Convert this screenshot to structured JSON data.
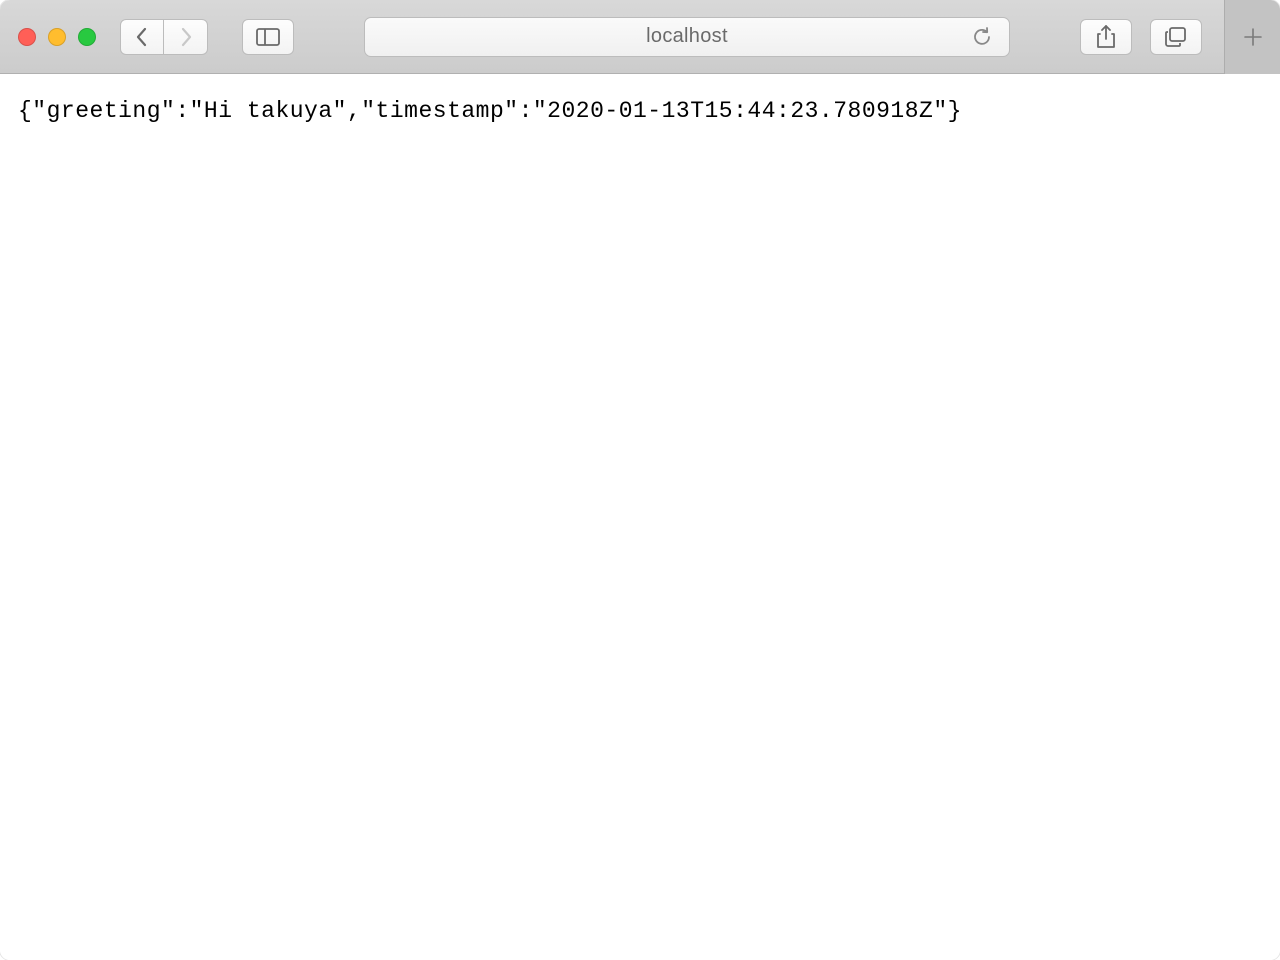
{
  "toolbar": {
    "address": "localhost"
  },
  "content": {
    "body_text": "{\"greeting\":\"Hi takuya\",\"timestamp\":\"2020-01-13T15:44:23.780918Z\"}"
  }
}
